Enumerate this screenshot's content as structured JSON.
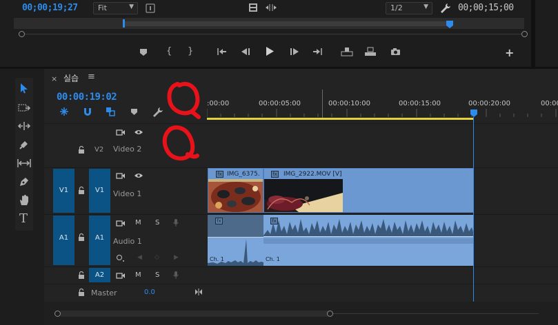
{
  "monitor": {
    "timecode_left": "00;00;19;27",
    "fit_select": "Fit",
    "resolution_select": "1/2",
    "timecode_right": "00;00;15;00"
  },
  "timeline": {
    "tab_title": "실습",
    "current_time": "00:00:19:02",
    "ruler_labels": [
      ":00:00",
      "00:00:05:00",
      "00:00:10:00",
      "00:00:15:00",
      "00:00:20:00",
      "00:00"
    ],
    "tracks": {
      "v2": {
        "label": "V2",
        "name": "Video 2"
      },
      "v1": {
        "source": "V1",
        "label": "V1",
        "name": "Video 1"
      },
      "a1": {
        "source": "A1",
        "label": "A1",
        "name": "Audio 1"
      },
      "a2": {
        "label": "A2"
      },
      "master": {
        "name": "Master",
        "value": "0.0"
      }
    },
    "track_buttons": {
      "mute": "M",
      "solo": "S"
    },
    "clips": {
      "video1": "IMG_6375.",
      "video2": "IMG_2922.MOV [V]",
      "audio_ch1": "Ch. 1",
      "audio_ch2": "Ch. 1"
    }
  },
  "colors": {
    "accent_blue": "#2d8ceb",
    "playhead": "#2d8ceb",
    "clip_video": "#6b98d0",
    "clip_audio": "#7aa6dc",
    "track_target": "#0b5385",
    "annotation_red": "#e8121b",
    "work_area_yellow": "#e3d23b"
  }
}
